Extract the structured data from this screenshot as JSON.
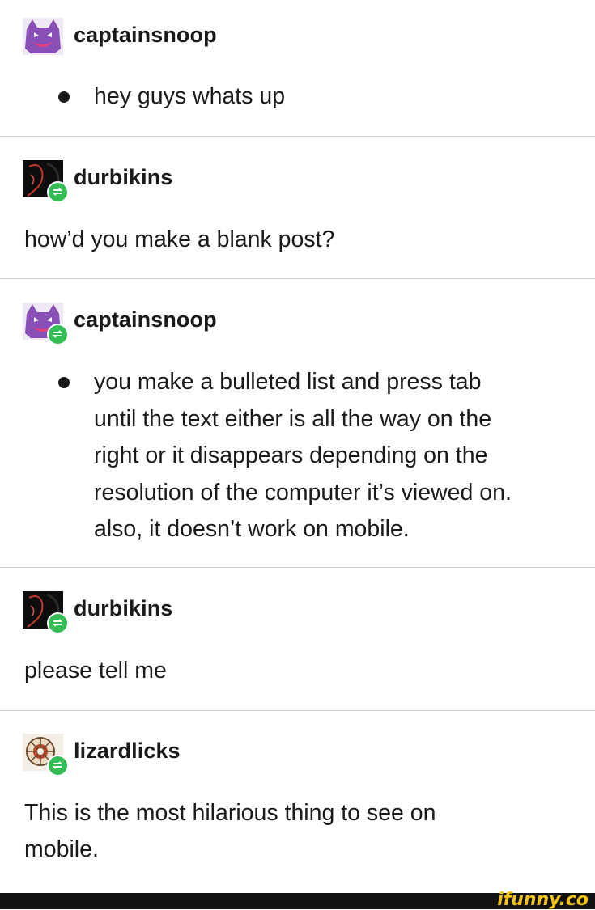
{
  "posts": [
    {
      "username": "captainsnoop",
      "bullet_text": "hey guys whats up",
      "avatar_icon": "purple-ghost-avatar-icon",
      "reblogged": false
    },
    {
      "username": "durbikins",
      "text": "how’d you make a blank post?",
      "avatar_icon": "dark-portrait-avatar-icon",
      "reblogged": true
    },
    {
      "username": "captainsnoop",
      "bullet_lines": [
        "you make a bulleted list and press tab",
        "until the text either is all the way on the",
        "right or it disappears depending on the",
        "resolution of the computer it’s viewed on.",
        "also, it doesn’t work on mobile."
      ],
      "avatar_icon": "purple-ghost-avatar-icon",
      "reblogged": true
    },
    {
      "username": "durbikins",
      "text": "please tell me",
      "avatar_icon": "dark-portrait-avatar-icon",
      "reblogged": true
    },
    {
      "username": "lizardlicks",
      "text_lines": [
        "This is the most hilarious thing to see on",
        "mobile."
      ],
      "avatar_icon": "mandala-avatar-icon",
      "reblogged": true
    }
  ],
  "watermark": "ifunny.co",
  "colors": {
    "reblog_badge": "#33bd55",
    "ghost_purple": "#8a4fb7",
    "divider": "#cfcfcf",
    "watermark": "#f2c413"
  }
}
